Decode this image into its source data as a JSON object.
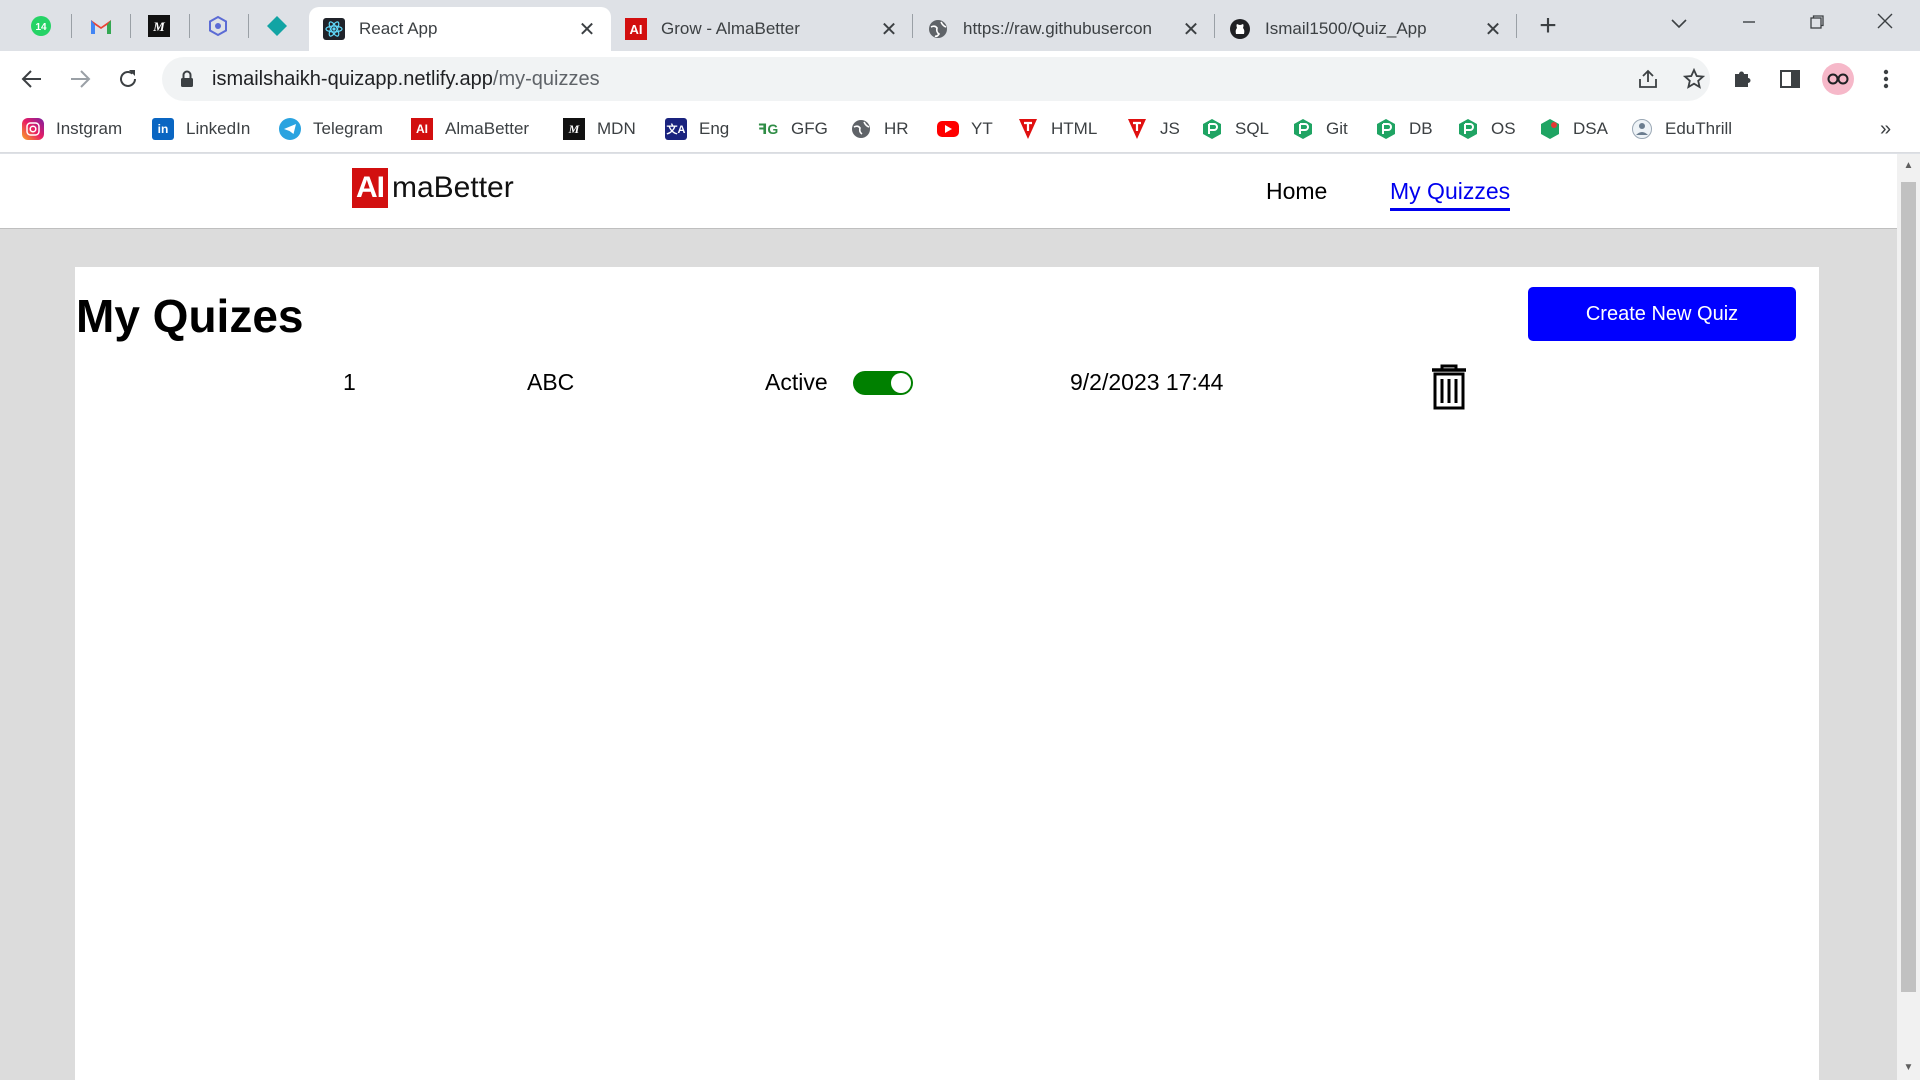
{
  "browser": {
    "pinned_tabs": [
      {
        "name": "whatsapp-tab",
        "badge": "14"
      },
      {
        "name": "gmail-tab"
      },
      {
        "name": "medium-tab"
      },
      {
        "name": "react-devtools-tab"
      },
      {
        "name": "diamond-tab"
      }
    ],
    "tabs": [
      {
        "title": "React App",
        "active": true
      },
      {
        "title": "Grow - AlmaBetter",
        "active": false
      },
      {
        "title": "https://raw.githubusercon",
        "active": false
      },
      {
        "title": "Ismail1500/Quiz_App",
        "active": false
      }
    ],
    "url_host": "ismailshaikh-quizapp.netlify.app",
    "url_path": "/my-quizzes",
    "bookmarks": [
      {
        "label": "Instgram",
        "icon": "instagram-icon"
      },
      {
        "label": "LinkedIn",
        "icon": "linkedin-icon"
      },
      {
        "label": "Telegram",
        "icon": "telegram-icon"
      },
      {
        "label": "AlmaBetter",
        "icon": "almabetter-icon"
      },
      {
        "label": "MDN",
        "icon": "mdn-icon"
      },
      {
        "label": "Eng",
        "icon": "translate-icon"
      },
      {
        "label": "GFG",
        "icon": "gfg-icon"
      },
      {
        "label": "HR",
        "icon": "globe-icon"
      },
      {
        "label": "YT",
        "icon": "youtube-icon"
      },
      {
        "label": "HTML",
        "icon": "t-icon"
      },
      {
        "label": "JS",
        "icon": "t-icon"
      },
      {
        "label": "SQL",
        "icon": "hex-icon"
      },
      {
        "label": "Git",
        "icon": "hex-icon"
      },
      {
        "label": "DB",
        "icon": "hex-icon"
      },
      {
        "label": "OS",
        "icon": "hex-icon"
      },
      {
        "label": "DSA",
        "icon": "leaf-icon"
      },
      {
        "label": "EduThrill",
        "icon": "eduthrill-icon"
      }
    ],
    "colors": {
      "tabstrip": "#dee1e6",
      "omnibox": "#f1f3f4"
    }
  },
  "app": {
    "logo_mark": "AI",
    "logo_text": "maBetter",
    "nav": {
      "home": "Home",
      "my_quizzes": "My Quizzes"
    },
    "page_title": "My Quizes",
    "create_button": "Create New Quiz",
    "quizzes": [
      {
        "index": "1",
        "title": "ABC",
        "status": "Active",
        "active": true,
        "created": "9/2/2023 17:44"
      }
    ],
    "colors": {
      "accent": "#0000ff",
      "toggle_on": "#008000",
      "logo_red": "#d20f0f"
    }
  }
}
